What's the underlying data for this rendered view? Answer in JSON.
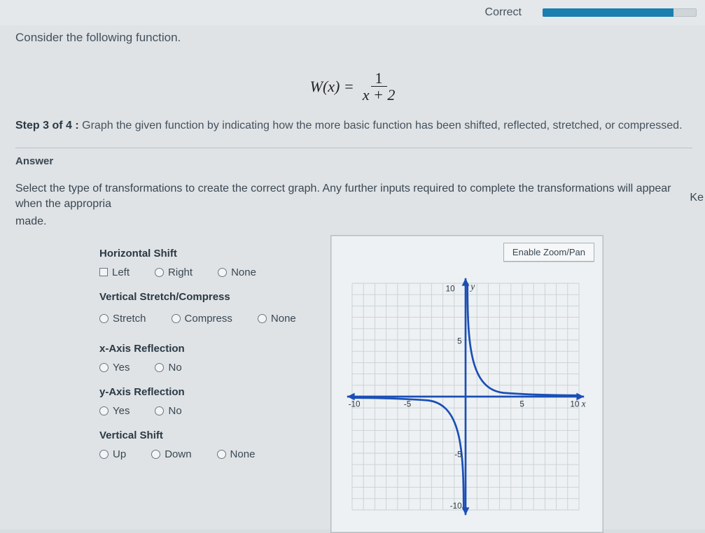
{
  "topbar": {
    "correct_label": "Correct",
    "progress_pct": 85
  },
  "question": {
    "prompt": "Consider the following function.",
    "formula_lhs": "W(x) =",
    "formula_num": "1",
    "formula_den": "x + 2",
    "step_label": "Step 3 of 4 :",
    "step_text": "Graph the given function by indicating how the more basic function has been shifted, reflected, stretched, or compressed."
  },
  "answer_label": "Answer",
  "hint_trunc": "Ke",
  "instruct": "Select the type of transformations to create the correct graph. Any further inputs required to complete the transformations will appear when the appropria",
  "instruct2": "made.",
  "groups": {
    "horizontal_shift": {
      "title": "Horizontal Shift",
      "options": {
        "left": "Left",
        "right": "Right",
        "none": "None"
      }
    },
    "vertical_stretch": {
      "title": "Vertical Stretch/Compress",
      "options": {
        "stretch": "Stretch",
        "compress": "Compress",
        "none": "None"
      }
    },
    "x_reflect": {
      "title": "x-Axis Reflection",
      "options": {
        "yes": "Yes",
        "no": "No"
      }
    },
    "y_reflect": {
      "title": "y-Axis Reflection",
      "options": {
        "yes": "Yes",
        "no": "No"
      }
    },
    "vertical_shift": {
      "title": "Vertical Shift",
      "options": {
        "up": "Up",
        "down": "Down",
        "none": "None"
      }
    }
  },
  "graph": {
    "zoom_label": "Enable Zoom/Pan",
    "x_label": "x",
    "y_label": "y",
    "ticks": {
      "neg10": "-10",
      "neg5": "-5",
      "pos5": "5",
      "pos10": "10"
    }
  },
  "chart_data": {
    "type": "line",
    "title": "",
    "xlabel": "x",
    "ylabel": "y",
    "xlim": [
      -10,
      10
    ],
    "ylim": [
      -10,
      10
    ],
    "note": "Graph of y = 1/x (basic reciprocal function) with asymptotes x=0 and y=0",
    "series": [
      {
        "name": "branch_negative_x",
        "x": [
          -10,
          -5,
          -2,
          -1,
          -0.5,
          -0.2,
          -0.1
        ],
        "y": [
          -0.1,
          -0.2,
          -0.5,
          -1,
          -2,
          -5,
          -10
        ]
      },
      {
        "name": "branch_positive_x",
        "x": [
          0.1,
          0.2,
          0.5,
          1,
          2,
          5,
          10
        ],
        "y": [
          10,
          5,
          2,
          1,
          0.5,
          0.2,
          0.1
        ]
      }
    ]
  }
}
